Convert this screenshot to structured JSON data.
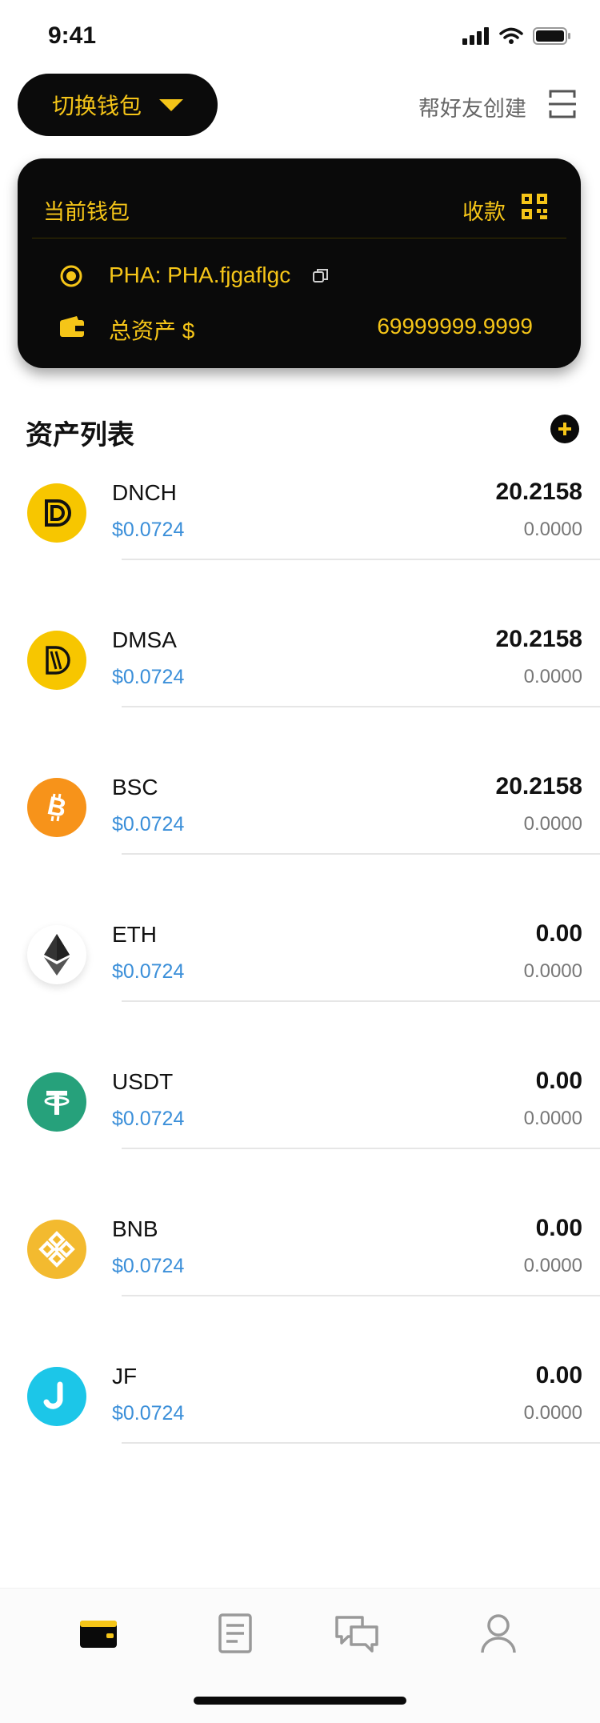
{
  "status_bar": {
    "time": "9:41"
  },
  "header": {
    "switch_wallet": "切换钱包",
    "help_create": "帮好友创建"
  },
  "wallet_card": {
    "title": "当前钱包",
    "receive": "收款",
    "address": "PHA: PHA.fjgaflgc",
    "total_label": "总资产 $",
    "total_value": "69999999.9999"
  },
  "assets": {
    "title": "资产列表",
    "items": [
      {
        "symbol": "DNCH",
        "price": "$0.0724",
        "balance": "20.2158",
        "value": "0.0000",
        "icon": "dnch-coin-icon",
        "color": "#F7C600"
      },
      {
        "symbol": "DMSA",
        "price": "$0.0724",
        "balance": "20.2158",
        "value": "0.0000",
        "icon": "dmsa-coin-icon",
        "color": "#F7C600"
      },
      {
        "symbol": "BSC",
        "price": "$0.0724",
        "balance": "20.2158",
        "value": "0.0000",
        "icon": "bitcoin-coin-icon",
        "color": "#F7931A"
      },
      {
        "symbol": "ETH",
        "price": "$0.0724",
        "balance": "0.00",
        "value": "0.0000",
        "icon": "ethereum-coin-icon",
        "color": "#FFFFFF"
      },
      {
        "symbol": "USDT",
        "price": "$0.0724",
        "balance": "0.00",
        "value": "0.0000",
        "icon": "tether-coin-icon",
        "color": "#26A17B"
      },
      {
        "symbol": "BNB",
        "price": "$0.0724",
        "balance": "0.00",
        "value": "0.0000",
        "icon": "bnb-coin-icon",
        "color": "#F3BA2F"
      },
      {
        "symbol": "JF",
        "price": "$0.0724",
        "balance": "0.00",
        "value": "0.0000",
        "icon": "jf-coin-icon",
        "color": "#1CC6E8"
      }
    ]
  },
  "colors": {
    "accent": "#F5C518",
    "price_blue": "#3B8FD9",
    "card_bg": "#0A0A0A"
  },
  "bottom_nav": [
    "wallet-icon",
    "document-icon",
    "chat-icon",
    "profile-icon"
  ]
}
